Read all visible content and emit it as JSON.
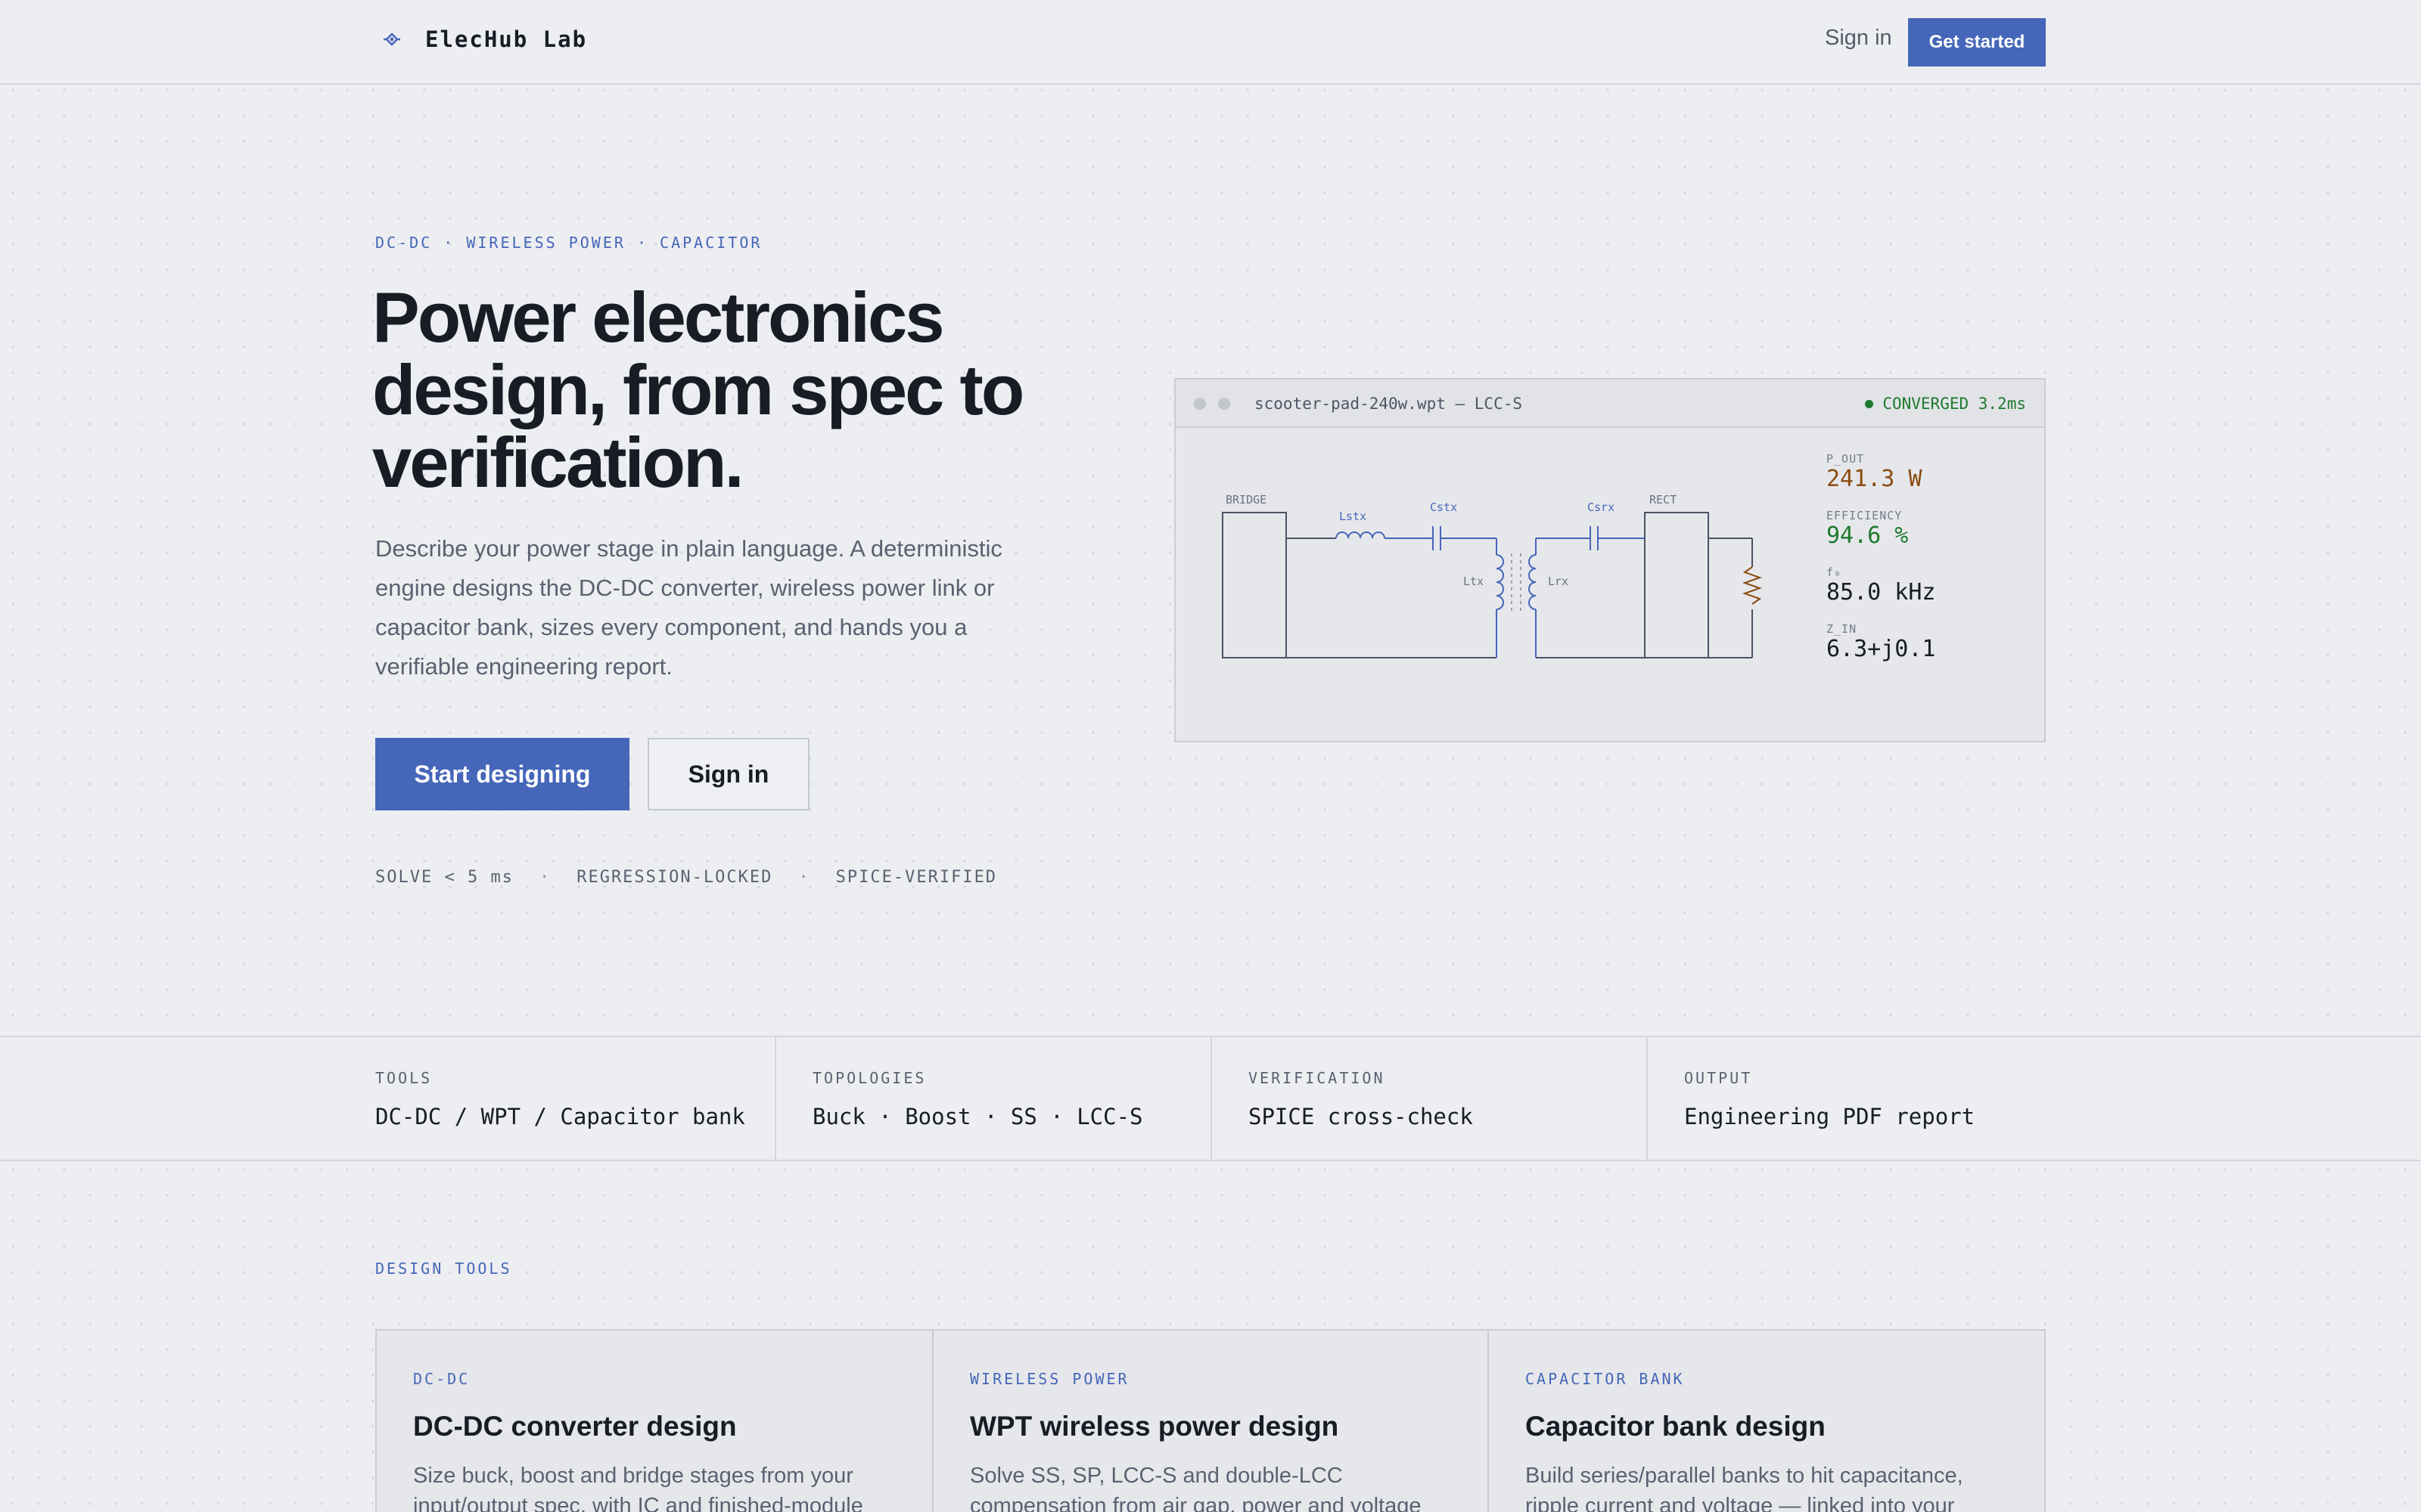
{
  "header": {
    "brand_name": "ElecHub Lab",
    "brand_icon": "circuit-node-icon",
    "sign_in": "Sign in",
    "get_started": "Get started"
  },
  "hero": {
    "eyebrow": "DC-DC · WIRELESS POWER · CAPACITOR",
    "title": "Power electronics design, from spec to verification.",
    "description": "Describe your power stage in plain language. A deterministic engine designs the DC-DC converter, wireless power link or capacitor bank, sizes every component, and hands you a verifiable engineering report.",
    "primary_cta": "Start designing",
    "secondary_cta": "Sign in",
    "trust_items": [
      "SOLVE < 5 ms",
      "REGRESSION-LOCKED",
      "SPICE-VERIFIED"
    ],
    "separator": "·"
  },
  "preview": {
    "file_name": "scooter-pad-240w.wpt — LCC-S",
    "status": "CONVERGED 3.2ms",
    "schematic_labels": {
      "bridge": "BRIDGE",
      "lstx": "Lstx",
      "cstx": "Cstx",
      "ltx": "Ltx",
      "lrx": "Lrx",
      "csrx": "Csrx",
      "rect": "RECT"
    },
    "metrics": [
      {
        "label": "P_OUT",
        "value": "241.3 W",
        "color": "#8a4b12"
      },
      {
        "label": "EFFICIENCY",
        "value": "94.6 %",
        "color": "#1d7a2c"
      },
      {
        "label": "f₀",
        "value": "85.0 kHz",
        "color": "#181c25"
      },
      {
        "label": "Z_IN",
        "value": "6.3+j0.1",
        "color": "#181c25"
      }
    ]
  },
  "stats": [
    {
      "label": "TOOLS",
      "value": "DC-DC / WPT / Capacitor bank"
    },
    {
      "label": "TOPOLOGIES",
      "value": "Buck · Boost · SS · LCC-S"
    },
    {
      "label": "VERIFICATION",
      "value": "SPICE cross-check"
    },
    {
      "label": "OUTPUT",
      "value": "Engineering PDF report"
    }
  ],
  "design_tools": {
    "section_label": "DESIGN TOOLS",
    "cards": [
      {
        "tag": "DC-DC",
        "title": "DC-DC converter design",
        "description": "Size buck, boost and bridge stages from your input/output spec, with IC and finished-module"
      },
      {
        "tag": "WIRELESS POWER",
        "title": "WPT wireless power design",
        "description": "Solve SS, SP, LCC-S and double-LCC compensation from air gap, power and voltage targets"
      },
      {
        "tag": "CAPACITOR BANK",
        "title": "Capacitor bank design",
        "description": "Build series/parallel banks to hit capacitance, ripple current and voltage — linked into your"
      }
    ]
  },
  "colors": {
    "accent": "#4566b9",
    "success": "#1d7a2c",
    "power": "#8a4b12",
    "background": "#edeef1"
  }
}
